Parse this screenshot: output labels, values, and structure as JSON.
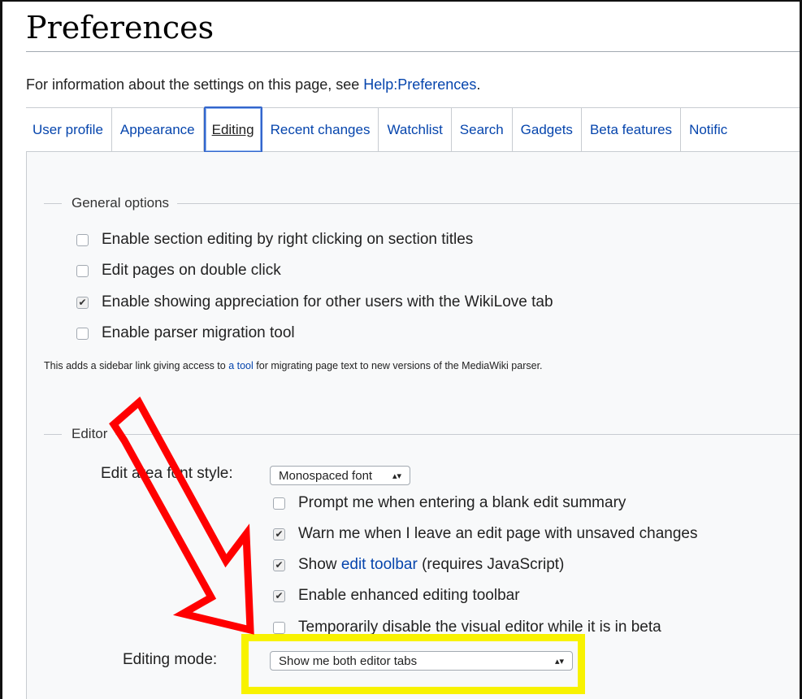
{
  "page": {
    "title": "Preferences",
    "intro_text": "For information about the settings on this page, see ",
    "intro_link": "Help:Preferences",
    "intro_end": "."
  },
  "tabs": [
    {
      "label": "User profile",
      "active": false
    },
    {
      "label": "Appearance",
      "active": false
    },
    {
      "label": "Editing",
      "active": true
    },
    {
      "label": "Recent changes",
      "active": false
    },
    {
      "label": "Watchlist",
      "active": false
    },
    {
      "label": "Search",
      "active": false
    },
    {
      "label": "Gadgets",
      "active": false
    },
    {
      "label": "Beta features",
      "active": false
    },
    {
      "label": "Notific",
      "active": false
    }
  ],
  "general": {
    "legend": "General options",
    "options": [
      {
        "label": "Enable section editing by right clicking on section titles",
        "checked": false
      },
      {
        "label": "Edit pages on double click",
        "checked": false
      },
      {
        "label": "Enable showing appreciation for other users with the WikiLove tab",
        "checked": true
      },
      {
        "label": "Enable parser migration tool",
        "checked": false
      }
    ],
    "note_before": "This adds a sidebar link giving access to ",
    "note_link": "a tool",
    "note_after": " for migrating page text to new versions of the MediaWiki parser."
  },
  "editor": {
    "legend": "Editor",
    "font_style_label": "Edit area font style:",
    "font_style_value": "Monospaced font",
    "options": [
      {
        "label": "Prompt me when entering a blank edit summary",
        "checked": false
      },
      {
        "label": "Warn me when I leave an edit page with unsaved changes",
        "checked": true
      },
      {
        "label_before": "Show ",
        "label_link": "edit toolbar",
        "label_after": " (requires JavaScript)",
        "checked": true
      },
      {
        "label": "Enable enhanced editing toolbar",
        "checked": true
      },
      {
        "label": "Temporarily disable the visual editor while it is in beta",
        "checked": false
      }
    ],
    "mode_label": "Editing mode:",
    "mode_value": "Show me both editor tabs"
  },
  "annotations": {
    "arrow_color": "#ff0000",
    "highlight_color": "#f8f200"
  },
  "icons": {
    "check": "✔",
    "select_arrows": "▴▾"
  }
}
